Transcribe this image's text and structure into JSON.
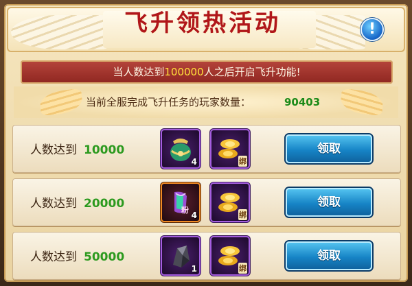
{
  "header": {
    "title": "飞升领热活动",
    "info_icon": "!"
  },
  "notice": {
    "prefix": "当人数达到",
    "number": "100000",
    "suffix": "人之后开启飞升功能!"
  },
  "stats": {
    "label": "当前全服完成飞升任务的玩家数量：",
    "value": "90403"
  },
  "rewards": [
    {
      "label": "人数达到",
      "target": "10000",
      "items": [
        {
          "icon": "green-pouch-icon",
          "count": "4"
        },
        {
          "icon": "gold-ingot-icon",
          "tag": "绑"
        }
      ],
      "button": "领取"
    },
    {
      "label": "人数达到",
      "target": "20000",
      "items": [
        {
          "icon": "purple-scroll-icon",
          "tag": "粉",
          "count": "4"
        },
        {
          "icon": "gold-ingot-icon",
          "tag": "绑"
        }
      ],
      "button": "领取"
    },
    {
      "label": "人数达到",
      "target": "50000",
      "items": [
        {
          "icon": "dark-stone-icon",
          "count": "1"
        },
        {
          "icon": "gold-ingot-icon",
          "tag": "绑"
        }
      ],
      "button": "领取"
    }
  ]
}
